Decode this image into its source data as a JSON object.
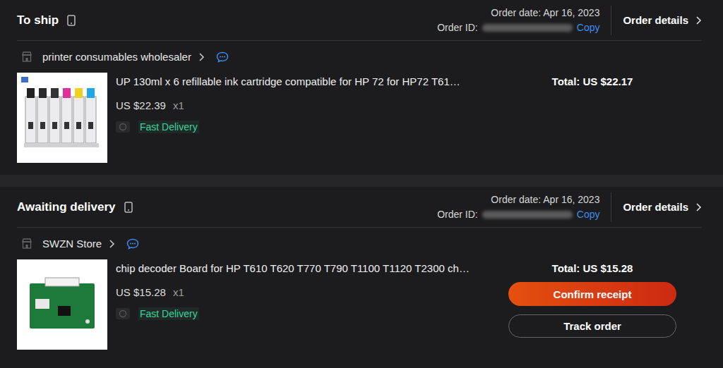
{
  "orders": [
    {
      "status": "To ship",
      "order_date": "Order date: Apr 16, 2023",
      "order_id_label": "Order ID:",
      "copy_link": "Copy",
      "details_link": "Order details",
      "store": "printer consumables wholesaler",
      "item": {
        "title": "UP 130ml x 6 refillable ink cartridge compatible for HP 72 for HP72 T61…",
        "price": "US $22.39",
        "quantity": "x1",
        "badge": "Fast Delivery",
        "kind": "cartridge"
      },
      "total": "Total: US $22.17",
      "actions": []
    },
    {
      "status": "Awaiting delivery",
      "order_date": "Order date: Apr 16, 2023",
      "order_id_label": "Order ID:",
      "copy_link": "Copy",
      "details_link": "Order details",
      "store": "SWZN Store",
      "item": {
        "title": "chip decoder Board for HP T610 T620 T770 T790 T1100 T1120 T2300 ch…",
        "price": "US $15.28",
        "quantity": "x1",
        "badge": "Fast Delivery",
        "kind": "board"
      },
      "total": "Total: US $15.28",
      "actions": [
        {
          "label": "Confirm receipt",
          "kind": "primary"
        },
        {
          "label": "Track order",
          "kind": "secondary"
        }
      ]
    }
  ]
}
